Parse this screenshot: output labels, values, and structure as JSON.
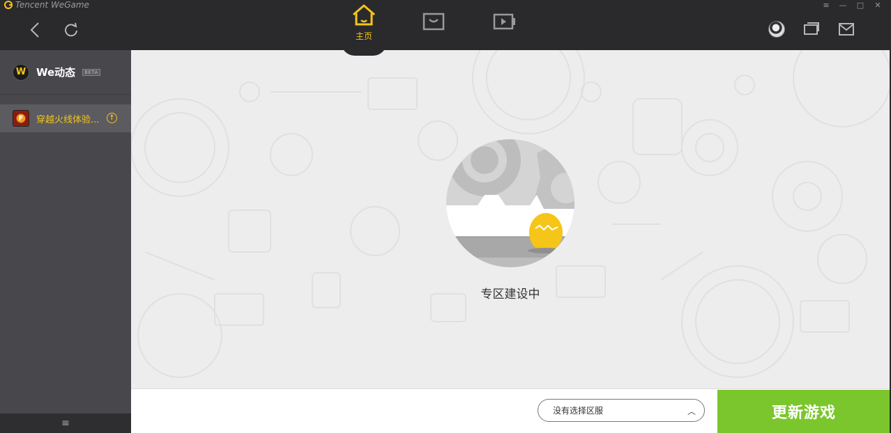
{
  "app": {
    "logo_text": "Tencent WeGame"
  },
  "window_controls": {
    "menu": "≡",
    "minimize": "—",
    "maximize": "□",
    "close": "✕"
  },
  "nav": {
    "back_icon": "back-arrow-icon",
    "refresh_icon": "refresh-icon"
  },
  "tabs": [
    {
      "label": "主页",
      "icon": "home-icon",
      "active": true
    },
    {
      "label": "",
      "icon": "store-icon",
      "active": false
    },
    {
      "label": "",
      "icon": "video-icon",
      "active": false
    }
  ],
  "sidebar": {
    "we_title": "We动态",
    "beta": "BETA",
    "game_label": "穿越火线体验...",
    "game_icon_text": "F",
    "bottom_menu": "≡"
  },
  "main": {
    "status": "专区建设中"
  },
  "bottom": {
    "server_placeholder": "没有选择区服",
    "update_button": "更新游戏"
  },
  "colors": {
    "accent": "#f5c518",
    "green": "#7bc62d",
    "bg_dark": "#2a2a2c",
    "sidebar": "#48484c"
  }
}
